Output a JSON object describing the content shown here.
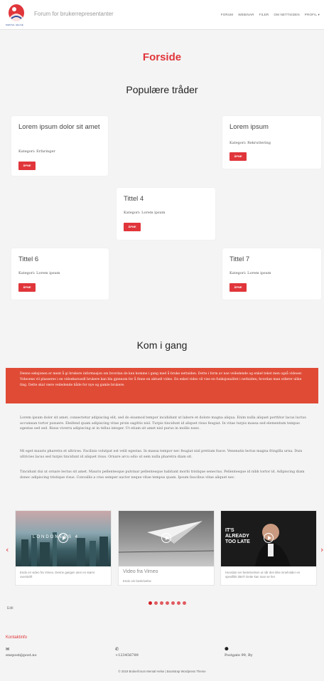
{
  "header": {
    "brand": "Forum for brukerrepresentanter",
    "logo_caption": "MENTAL HELSE",
    "nav": [
      "FORUM",
      "WEBINAR",
      "FILER",
      "OM NETTSIDEN",
      "PROFIL ▾"
    ]
  },
  "page_title": "Forside",
  "popular": {
    "heading": "Populære tråder",
    "button_label": "ÅPNE",
    "cards": [
      {
        "title": "Lorem ipsum dolor sit amet",
        "category": "Kategori: Erfaringer"
      },
      {
        "title": "Lorem ipsum",
        "category": "Kategori: Rekruttering"
      },
      {
        "title": "Tittel 4",
        "category": "Kategori: Lorem ipsum"
      },
      {
        "title": "Tittel 6",
        "category": "Kategori: Lorem ipsum"
      },
      {
        "title": "Tittel 7",
        "category": "Kategori: Lorem ipsum"
      }
    ]
  },
  "getting_started": {
    "heading": "Kom i gang",
    "banner": "Denne seksjonen er ment å gi brukere informasjon om hvordan de kan komme i gang med å bruke nettsiden. Dette i form av noe veiledende og enkel tekst men også videoer. Videoene vil plasseres i en vidoekarusell brukere kan bla gjennom for å finne en aktuell video. En enkel video vil vise en funksjonalitet i nettsiden; hvordan man utfører ulike ting. Dette skal være veiledende både for nye og gamle brukere.",
    "paragraphs": [
      "Lorem ipsum dolor sit amet, consectetur adipiscing elit, sed do eiusmod tempor incididunt ut labore et dolore magna aliqua. Enim nulla aliquet porttitor lacus luctus accumsan tortor posuere. Eleifend quam adipiscing vitae proin sagittis nisl. Turpis tincidunt id aliquet risus feugiat. In vitae turpis massa sed elementum tempus egestas sed sed. Risus viverra adipiscing at in tellus integer. Ut etiam sit amet nisl purus in mollis nunc.",
      "Mi eget mauris pharetra et ultrices. Facilisis volutpat est velit egestas. In massa tempor nec feugiat nisl pretium fusce. Venenatis lectus magna fringilla urna. Duis ultricies lacus sed turpis tincidunt id aliquet risus. Ornare arcu odio ut sem nulla pharetra diam sit.",
      "Tincidunt dui ut ornare lectus sit amet. Mauris pellentesque pulvinar pellentesque habitant morbi tristique senectus. Pellentesque id nibh tortor id. Adipiscing diam donec adipiscing tristique risus. Convallis a cras semper auctor neque vitae tempus quam. Ipsum faucibus vitae aliquet nec."
    ]
  },
  "videos": [
    {
      "title": "",
      "thumb_text": "LONDONERS 4",
      "description": "Endo en video fra Vimeo. Denne gangen uten en større overskrift"
    },
    {
      "title": "Video fra Vimeo",
      "thumb_text": "",
      "description": "Endo om beskrivelse"
    },
    {
      "title": "",
      "thumb_text": "IT'S ALREADY TOO LATE",
      "description": "Hvordan ser beskrivelsen ut når den ikke inneholder en spesifikk tittel? Dette kan man se her"
    }
  ],
  "carousel": {
    "prev": "‹",
    "next": "›",
    "dot_count": 7,
    "active_dot": 0
  },
  "edit_label": "Edit",
  "contact": {
    "heading": "Kontaktinfo",
    "email": "enepost@post.no",
    "phone": "+123456789",
    "address": "Postgate 99, By",
    "email_icon": "✉",
    "phone_icon": "✆",
    "address_icon": "⬤"
  },
  "footer": "© 2019 Brukerforum Mental Helse | Bootstrap Wordpress Theme",
  "colors": {
    "accent": "#e0353a",
    "banner": "#e04b35"
  }
}
